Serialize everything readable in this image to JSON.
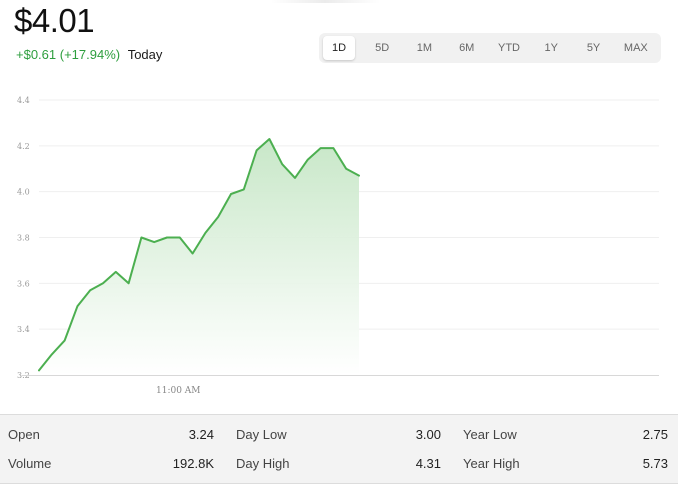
{
  "quote": {
    "price": "$4.01",
    "change": "+$0.61 (+17.94%)",
    "period_label": "Today"
  },
  "ranges": [
    "1D",
    "5D",
    "1M",
    "6M",
    "YTD",
    "1Y",
    "5Y",
    "MAX"
  ],
  "active_range": "1D",
  "colors": {
    "line": "#4caf50",
    "positive": "#2e9e3e",
    "fill_top": "#c5e6c5"
  },
  "chart_data": {
    "type": "area",
    "y": [
      3.22,
      3.29,
      3.35,
      3.5,
      3.57,
      3.6,
      3.65,
      3.6,
      3.8,
      3.78,
      3.8,
      3.8,
      3.73,
      3.82,
      3.89,
      3.99,
      4.01,
      4.18,
      4.23,
      4.12,
      4.06,
      4.14,
      4.19,
      4.19,
      4.1,
      4.07
    ],
    "ylim": [
      3.2,
      4.4
    ],
    "yticks": [
      "4.4",
      "4.2",
      "4.0",
      "3.8",
      "3.6",
      "3.4",
      "3.2"
    ],
    "xtick_label": "11:00 AM",
    "grid": true
  },
  "stats": [
    {
      "label": "Open",
      "value": "3.24"
    },
    {
      "label": "Day Low",
      "value": "3.00"
    },
    {
      "label": "Year Low",
      "value": "2.75"
    },
    {
      "label": "Volume",
      "value": "192.8K"
    },
    {
      "label": "Day High",
      "value": "4.31"
    },
    {
      "label": "Year High",
      "value": "5.73"
    }
  ]
}
